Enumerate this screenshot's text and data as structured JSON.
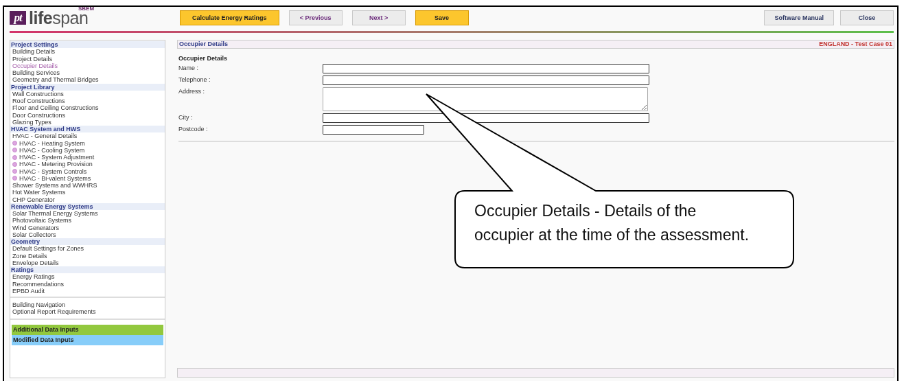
{
  "logo": {
    "mark": "pt",
    "name": "**life**span",
    "badge": "SBEM"
  },
  "toolbar": {
    "left_buttons": [
      {
        "label": "Calculate Energy Ratings",
        "kind": "primary"
      },
      {
        "label": "< Previous",
        "kind": "nav"
      },
      {
        "label": "Next >",
        "kind": "nav"
      },
      {
        "label": "Save",
        "kind": "primary"
      }
    ],
    "right_buttons": [
      {
        "label": "Software Manual"
      },
      {
        "label": "Close"
      }
    ]
  },
  "sidebar": {
    "sections": [
      {
        "title": "Project Settings",
        "items": [
          {
            "label": "Building Details",
            "kind": "plain",
            "selected": false
          },
          {
            "label": "Project Details",
            "kind": "plain",
            "selected": false
          },
          {
            "label": "Occupier Details",
            "kind": "plain",
            "selected": true
          },
          {
            "label": "Building Services",
            "kind": "plain",
            "selected": false
          },
          {
            "label": "Geometry and Thermal Bridges",
            "kind": "plain",
            "selected": false
          }
        ]
      },
      {
        "title": "Project Library",
        "items": [
          {
            "label": "Wall Constructions",
            "kind": "plain",
            "selected": false
          },
          {
            "label": "Roof Constructions",
            "kind": "plain",
            "selected": false
          },
          {
            "label": "Floor and Ceiling Constructions",
            "kind": "plain",
            "selected": false
          },
          {
            "label": "Door Constructions",
            "kind": "plain",
            "selected": false
          },
          {
            "label": "Glazing Types",
            "kind": "plain",
            "selected": false
          }
        ]
      },
      {
        "title": "HVAC System and HWS",
        "items": [
          {
            "label": "HVAC - General Details",
            "kind": "plain",
            "selected": false
          },
          {
            "label": "HVAC - Heating System",
            "kind": "bullet",
            "selected": false
          },
          {
            "label": "HVAC - Cooling System",
            "kind": "bullet",
            "selected": false
          },
          {
            "label": "HVAC - System Adjustment",
            "kind": "bullet",
            "selected": false
          },
          {
            "label": "HVAC - Metering Provision",
            "kind": "bullet",
            "selected": false
          },
          {
            "label": "HVAC - System Controls",
            "kind": "bullet",
            "selected": false
          },
          {
            "label": "HVAC - Bi-valent Systems",
            "kind": "bullet",
            "selected": false
          },
          {
            "label": "Shower Systems and WWHRS",
            "kind": "plain",
            "selected": false
          },
          {
            "label": "Hot Water Systems",
            "kind": "plain",
            "selected": false
          },
          {
            "label": "CHP Generator",
            "kind": "plain",
            "selected": false
          }
        ]
      },
      {
        "title": "Renewable Energy Systems",
        "items": [
          {
            "label": "Solar Thermal Energy Systems",
            "kind": "plain",
            "selected": false
          },
          {
            "label": "Photovoltaic Systems",
            "kind": "plain",
            "selected": false
          },
          {
            "label": "Wind Generators",
            "kind": "plain",
            "selected": false
          },
          {
            "label": "Solar Collectors",
            "kind": "plain",
            "selected": false
          }
        ]
      },
      {
        "title": "Geometry",
        "items": [
          {
            "label": "Default Settings for Zones",
            "kind": "plain",
            "selected": false
          },
          {
            "label": "Zone Details",
            "kind": "plain",
            "selected": false
          },
          {
            "label": "Envelope Details",
            "kind": "plain",
            "selected": false
          }
        ]
      },
      {
        "title": "Ratings",
        "items": [
          {
            "label": "Energy Ratings",
            "kind": "plain",
            "selected": false
          },
          {
            "label": "Recommendations",
            "kind": "plain",
            "selected": false
          },
          {
            "label": "EPBD Audit",
            "kind": "plain",
            "selected": false
          }
        ]
      }
    ],
    "extra_items": [
      {
        "label": "Building Navigation",
        "selected": false
      },
      {
        "label": "Optional Report Requirements",
        "selected": false
      }
    ],
    "legend": [
      {
        "label": "Additional Data Inputs",
        "color": "#92c83e"
      },
      {
        "label": "Modified Data Inputs",
        "color": "#87cdf9"
      }
    ]
  },
  "main": {
    "title": "Occupier Details",
    "project": "ENGLAND - Test Case 01",
    "form_title": "Occupier Details",
    "fields": [
      {
        "label": "Name :",
        "kind": "text"
      },
      {
        "label": "Telephone :",
        "kind": "text"
      },
      {
        "label": "Address :",
        "kind": "textarea"
      },
      {
        "label": "City :",
        "kind": "text"
      },
      {
        "label": "Postcode :",
        "kind": "short"
      }
    ]
  },
  "callout": {
    "text": "Occupier Details - Details of the occupier at the time of the assessment."
  }
}
